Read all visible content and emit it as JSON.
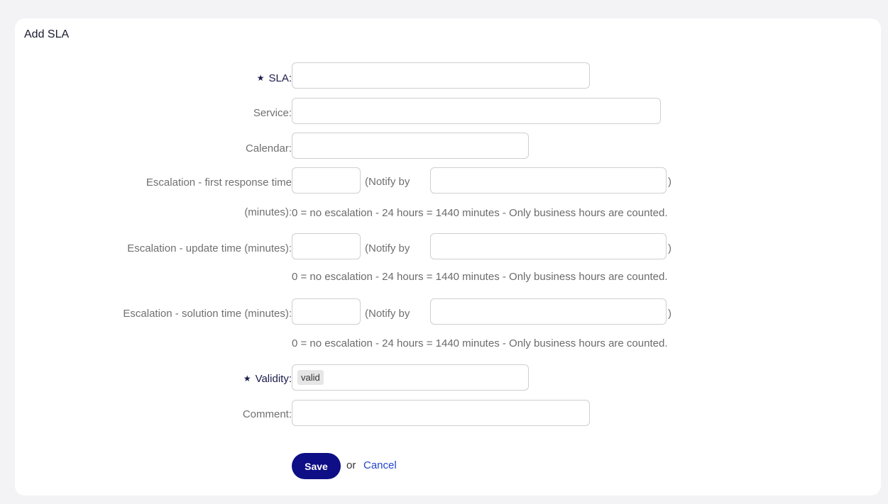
{
  "form": {
    "title": "Add SLA",
    "sla_label": "SLA:",
    "service_label": "Service:",
    "calendar_label": "Calendar:",
    "first_response_label_line1": "Escalation - first response time",
    "first_response_label_line2": "(minutes):",
    "update_label": "Escalation - update time (minutes):",
    "solution_label": "Escalation - solution time (minutes):",
    "notify_by_label": "(Notify by",
    "close_paren": ")",
    "escalation_hint": "0 = no escalation - 24 hours = 1440 minutes - Only business hours are counted.",
    "validity_label": "Validity:",
    "validity_value": "valid",
    "comment_label": "Comment:",
    "required_marker": "★"
  },
  "actions": {
    "save_label": "Save",
    "or_text": "or",
    "cancel_label": "Cancel"
  }
}
